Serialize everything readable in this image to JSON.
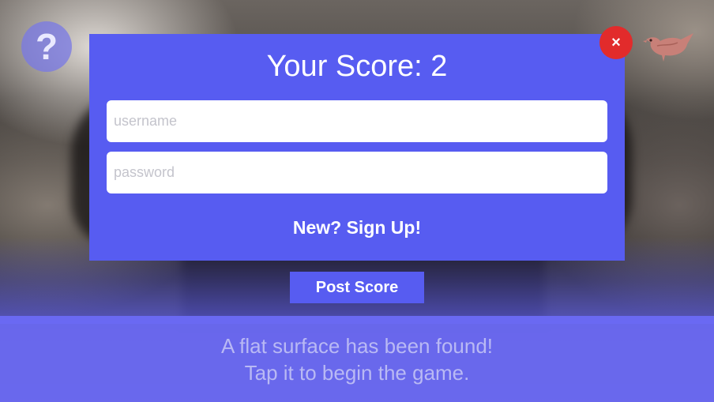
{
  "help_button": {
    "label": "?"
  },
  "close_button": {
    "label": "×"
  },
  "mascot": {
    "icon": "bird-icon",
    "color": "#c88078"
  },
  "modal": {
    "title": "Your Score: 2",
    "username": {
      "placeholder": "username",
      "value": ""
    },
    "password": {
      "placeholder": "password",
      "value": ""
    },
    "signup_label": "New? Sign Up!",
    "background": "#575cf1"
  },
  "post_score_label": "Post Score",
  "banner": {
    "line1": "A flat surface has been found!",
    "line2": "Tap it to begin the game."
  },
  "colors": {
    "accent": "#575cf1",
    "close": "#e22b2b"
  }
}
